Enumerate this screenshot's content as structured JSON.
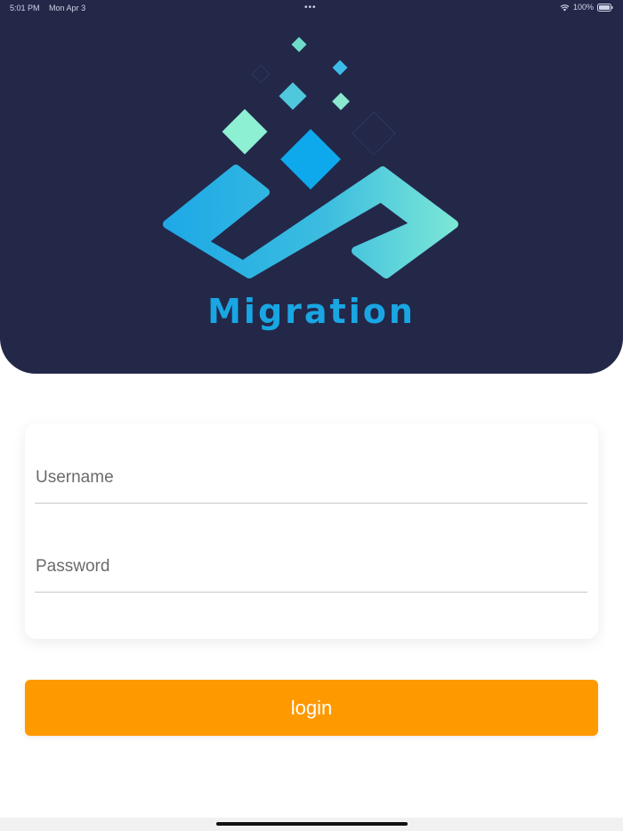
{
  "status_bar": {
    "time": "5:01 PM",
    "date": "Mon Apr 3",
    "battery": "100%",
    "icons": [
      "multitasking-dots-icon",
      "wifi-icon",
      "battery-icon"
    ]
  },
  "logo": {
    "text": "Migration",
    "colors": {
      "primary": "#1aa7e8",
      "accent": "#7fe8d0"
    }
  },
  "form": {
    "username_placeholder": "Username",
    "username_value": "",
    "password_placeholder": "Password",
    "password_value": ""
  },
  "login_button": {
    "label": "login",
    "color": "#ff9900"
  },
  "colors": {
    "header_bg": "#232849",
    "page_bg": "#ffffff"
  }
}
